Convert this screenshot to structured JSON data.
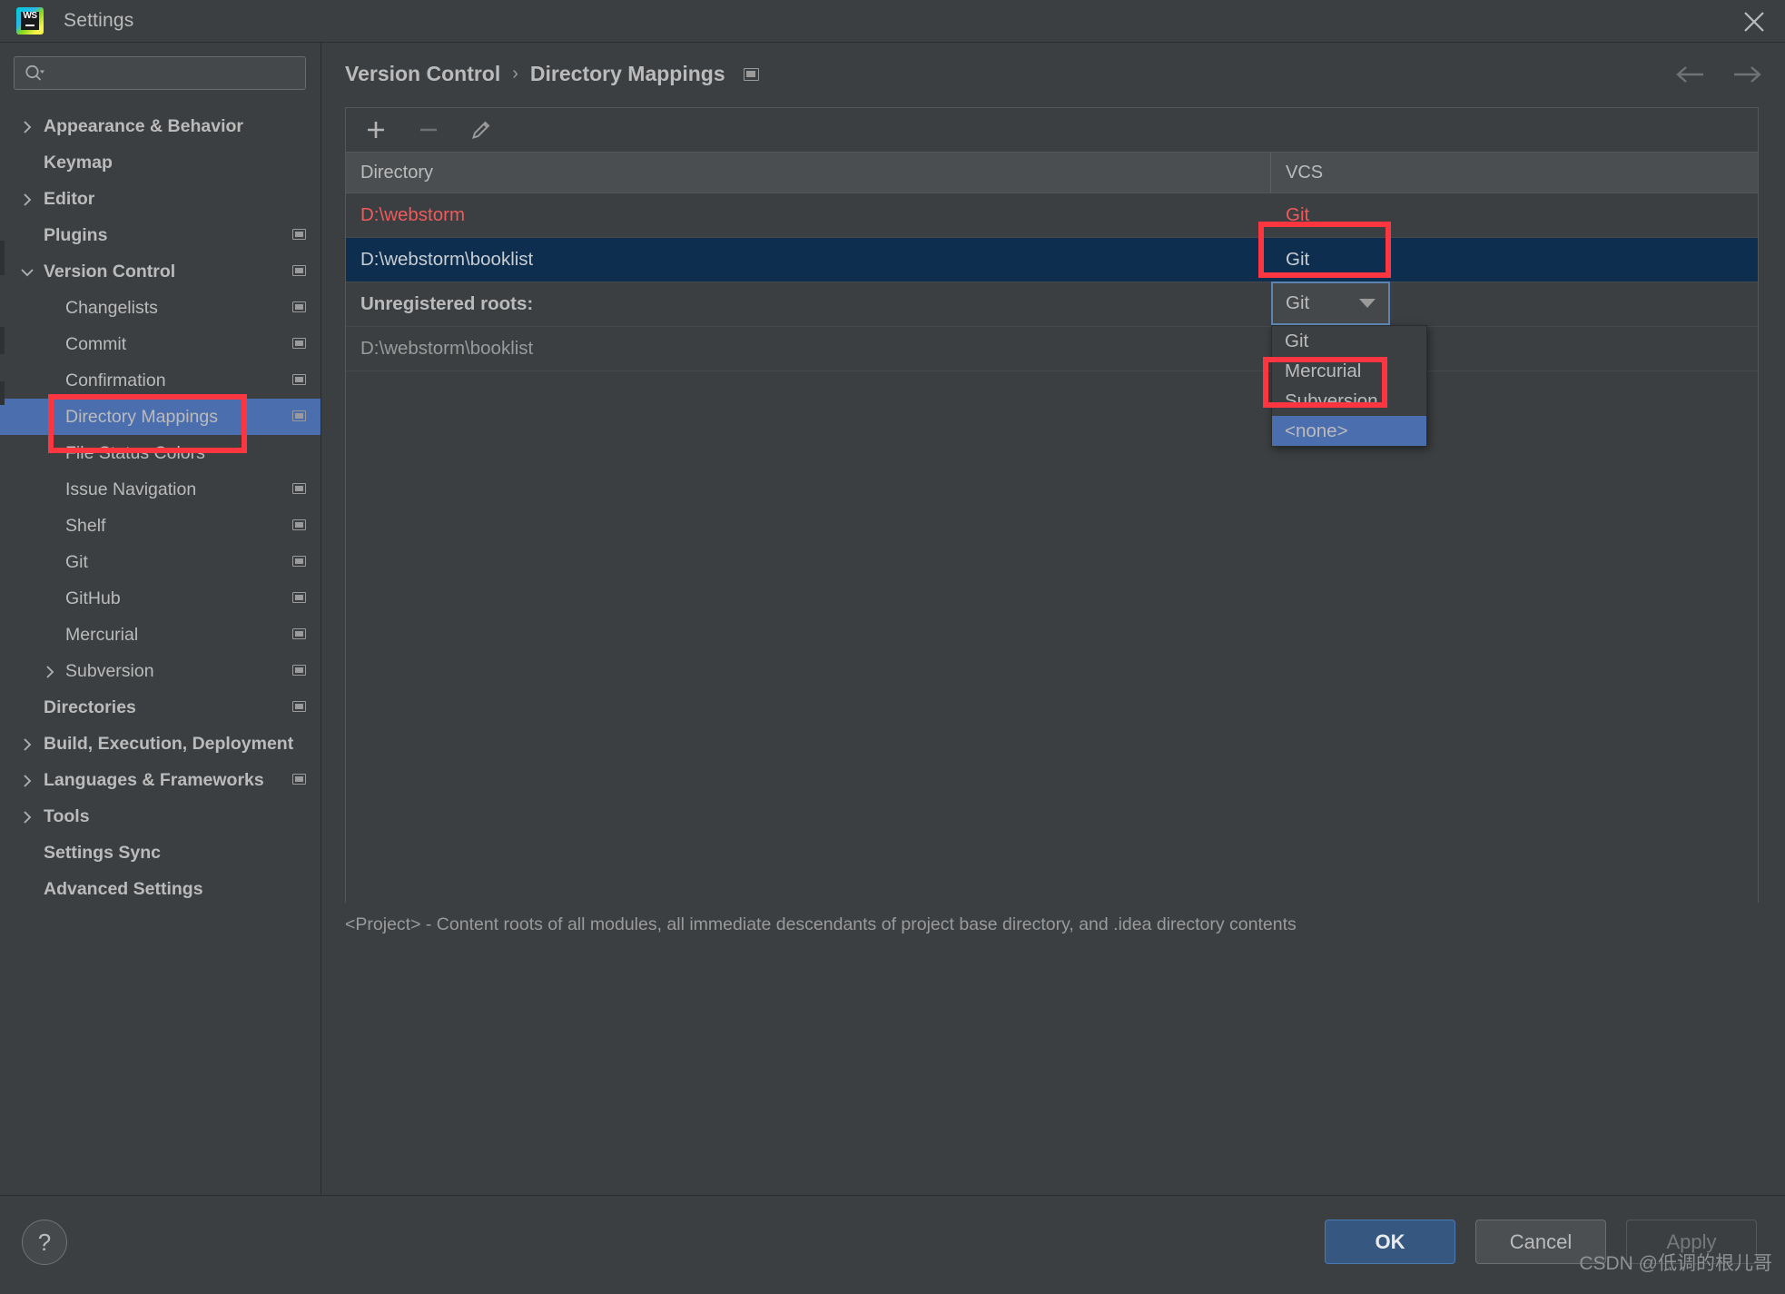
{
  "window": {
    "title": "Settings",
    "app_icon": "webstorm-logo",
    "close_icon": "close-icon"
  },
  "search": {
    "value": "",
    "placeholder": "",
    "icon": "search-icon"
  },
  "sidebar": {
    "items": [
      {
        "label": "Appearance & Behavior",
        "indent": 0,
        "bold": true,
        "arrow": "right",
        "monitor": false,
        "selected": false
      },
      {
        "label": "Keymap",
        "indent": 0,
        "bold": true,
        "arrow": "none",
        "monitor": false,
        "selected": false
      },
      {
        "label": "Editor",
        "indent": 0,
        "bold": true,
        "arrow": "right",
        "monitor": false,
        "selected": false
      },
      {
        "label": "Plugins",
        "indent": 0,
        "bold": true,
        "arrow": "none",
        "monitor": true,
        "selected": false
      },
      {
        "label": "Version Control",
        "indent": 0,
        "bold": true,
        "arrow": "down",
        "monitor": true,
        "selected": false
      },
      {
        "label": "Changelists",
        "indent": 1,
        "bold": false,
        "arrow": "none",
        "monitor": true,
        "selected": false
      },
      {
        "label": "Commit",
        "indent": 1,
        "bold": false,
        "arrow": "none",
        "monitor": true,
        "selected": false
      },
      {
        "label": "Confirmation",
        "indent": 1,
        "bold": false,
        "arrow": "none",
        "monitor": true,
        "selected": false
      },
      {
        "label": "Directory Mappings",
        "indent": 1,
        "bold": false,
        "arrow": "none",
        "monitor": true,
        "selected": true
      },
      {
        "label": "File Status Colors",
        "indent": 1,
        "bold": false,
        "arrow": "none",
        "monitor": false,
        "selected": false
      },
      {
        "label": "Issue Navigation",
        "indent": 1,
        "bold": false,
        "arrow": "none",
        "monitor": true,
        "selected": false
      },
      {
        "label": "Shelf",
        "indent": 1,
        "bold": false,
        "arrow": "none",
        "monitor": true,
        "selected": false
      },
      {
        "label": "Git",
        "indent": 1,
        "bold": false,
        "arrow": "none",
        "monitor": true,
        "selected": false
      },
      {
        "label": "GitHub",
        "indent": 1,
        "bold": false,
        "arrow": "none",
        "monitor": true,
        "selected": false
      },
      {
        "label": "Mercurial",
        "indent": 1,
        "bold": false,
        "arrow": "none",
        "monitor": true,
        "selected": false
      },
      {
        "label": "Subversion",
        "indent": 1,
        "bold": false,
        "arrow": "right",
        "monitor": true,
        "selected": false
      },
      {
        "label": "Directories",
        "indent": 0,
        "bold": true,
        "arrow": "none",
        "monitor": true,
        "selected": false
      },
      {
        "label": "Build, Execution, Deployment",
        "indent": 0,
        "bold": true,
        "arrow": "right",
        "monitor": false,
        "selected": false
      },
      {
        "label": "Languages & Frameworks",
        "indent": 0,
        "bold": true,
        "arrow": "right",
        "monitor": true,
        "selected": false
      },
      {
        "label": "Tools",
        "indent": 0,
        "bold": true,
        "arrow": "right",
        "monitor": false,
        "selected": false
      },
      {
        "label": "Settings Sync",
        "indent": 0,
        "bold": true,
        "arrow": "none",
        "monitor": false,
        "selected": false
      },
      {
        "label": "Advanced Settings",
        "indent": 0,
        "bold": true,
        "arrow": "none",
        "monitor": false,
        "selected": false
      }
    ]
  },
  "main": {
    "breadcrumb": {
      "parent": "Version Control",
      "separator": "›",
      "current": "Directory Mappings",
      "monitor_icon": "monitor-icon"
    },
    "nav": {
      "back_icon": "arrow-left-icon",
      "forward_icon": "arrow-right-icon"
    },
    "toolbar": {
      "add_icon": "plus-icon",
      "remove_icon": "minus-icon",
      "edit_icon": "pencil-icon"
    },
    "table": {
      "columns": [
        "Directory",
        "VCS"
      ],
      "rows": [
        {
          "directory": "D:\\webstorm",
          "vcs": "Git",
          "style": "invalid",
          "selected": false
        },
        {
          "directory": "D:\\webstorm\\booklist",
          "vcs": "Git",
          "style": "normal",
          "selected": true
        },
        {
          "directory": "Unregistered roots:",
          "vcs": "",
          "style": "section",
          "selected": false
        },
        {
          "directory": "D:\\webstorm\\booklist",
          "vcs": "",
          "style": "muted",
          "selected": false
        }
      ]
    },
    "combo": {
      "value": "Git",
      "caret_icon": "chevron-down-icon",
      "options": [
        "Git",
        "Mercurial",
        "Subversion",
        "<none>"
      ],
      "highlighted_option": "<none>"
    },
    "hint": "<Project> - Content roots of all modules, all immediate descendants of project base directory, and .idea directory contents"
  },
  "footer": {
    "help_label": "?",
    "ok_label": "OK",
    "cancel_label": "Cancel",
    "apply_label": "Apply",
    "watermark": "CSDN @低调的根儿哥"
  },
  "colors": {
    "accent_blue": "#4b6eaf",
    "selection_row": "#0d2e4e",
    "invalid_red": "#f05a5a",
    "annotation_red": "#fb3640",
    "panel_bg": "#3c3f41"
  }
}
